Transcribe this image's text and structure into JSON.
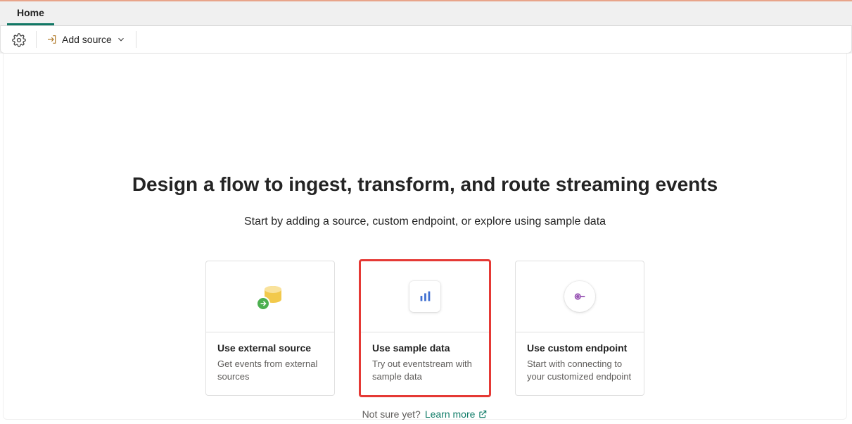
{
  "tabs": [
    {
      "label": "Home",
      "active": true
    }
  ],
  "toolbar": {
    "add_source_label": "Add source"
  },
  "page": {
    "heading": "Design a flow to ingest, transform, and route streaming events",
    "subheading": "Start by adding a source, custom endpoint, or explore using sample data"
  },
  "cards": [
    {
      "title": "Use external source",
      "desc": "Get events from external sources",
      "icon": "database-arrow-icon",
      "highlight": false
    },
    {
      "title": "Use sample data",
      "desc": "Try out eventstream with sample data",
      "icon": "bar-chart-icon",
      "highlight": true
    },
    {
      "title": "Use custom endpoint",
      "desc": "Start with connecting to your customized endpoint",
      "icon": "endpoint-icon",
      "highlight": false
    }
  ],
  "footer": {
    "not_sure": "Not sure yet?",
    "learn_more": "Learn more"
  }
}
